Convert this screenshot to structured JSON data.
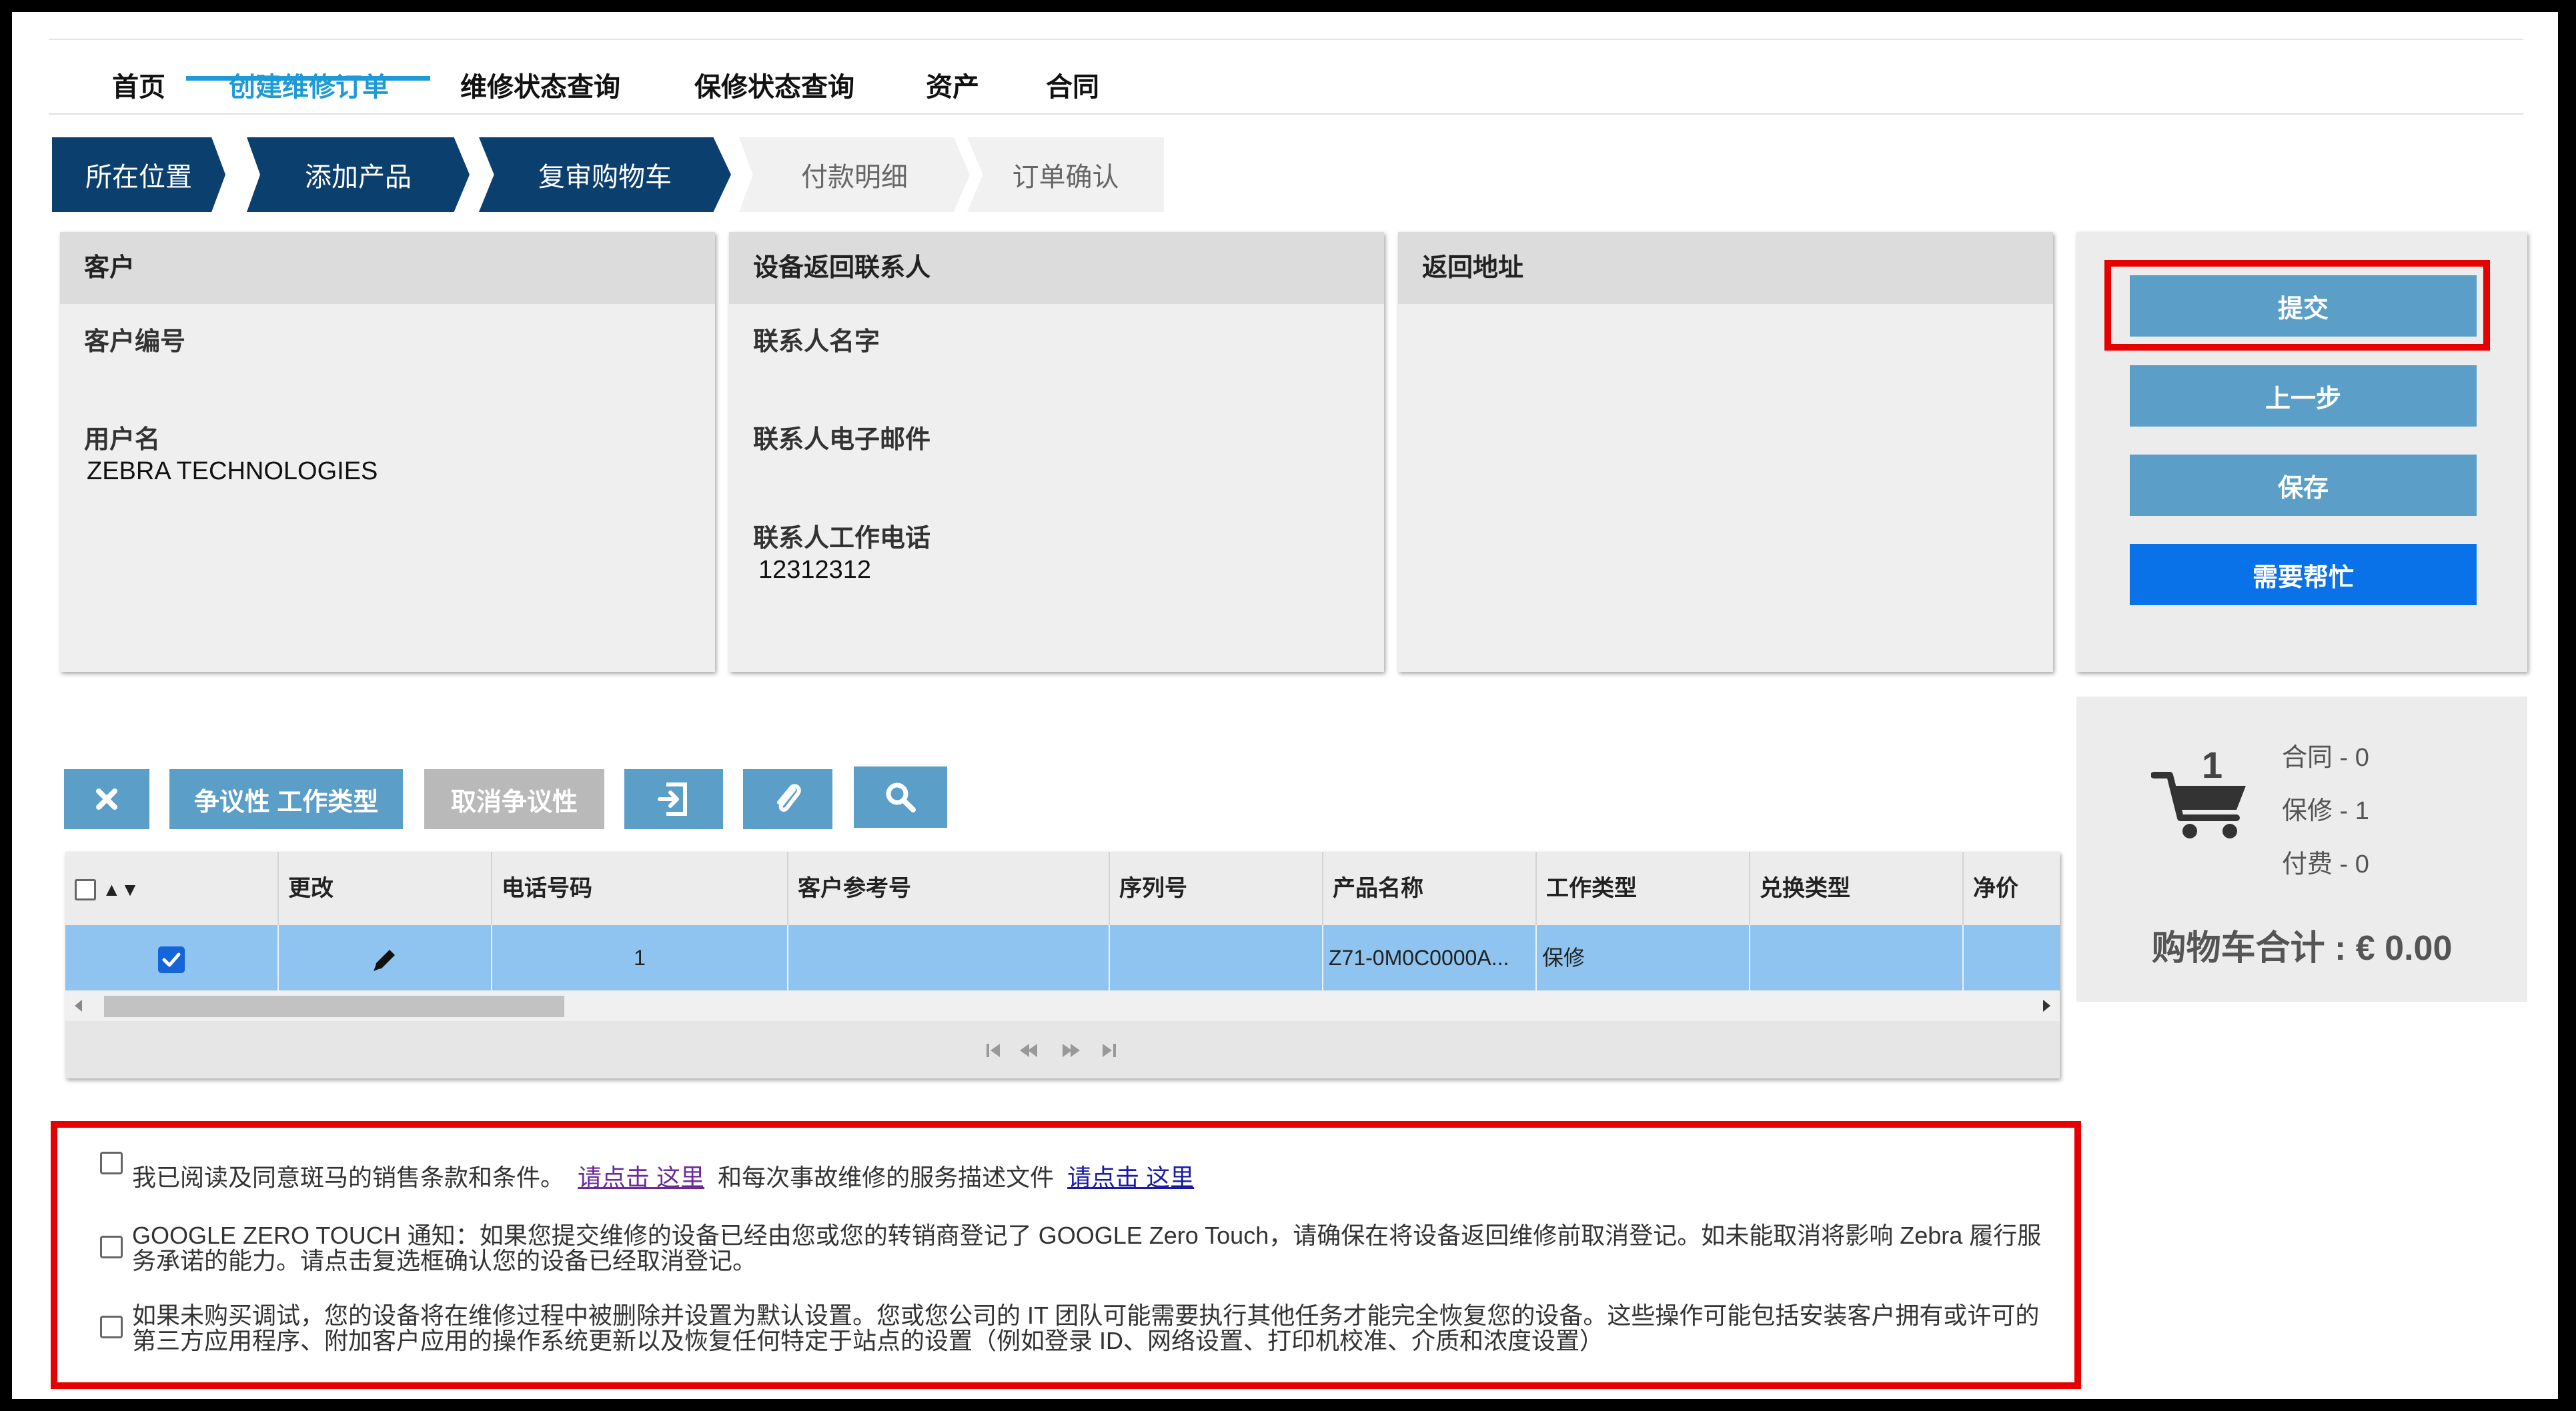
{
  "nav": {
    "items": [
      {
        "label": "首页"
      },
      {
        "label": "创建维修订单",
        "active": true
      },
      {
        "label": "维修状态查询"
      },
      {
        "label": "保修状态查询"
      },
      {
        "label": "资产"
      },
      {
        "label": "合同"
      }
    ]
  },
  "steps": [
    {
      "label": "所在位置",
      "done": true
    },
    {
      "label": "添加产品",
      "done": true
    },
    {
      "label": "复审购物车",
      "done": true
    },
    {
      "label": "付款明细",
      "done": false
    },
    {
      "label": "订单确认",
      "done": false
    }
  ],
  "customer": {
    "title": "客户",
    "number_label": "客户编号",
    "username_label": "用户名",
    "username_value": "ZEBRA TECHNOLOGIES"
  },
  "contact": {
    "title": "设备返回联系人",
    "name_label": "联系人名字",
    "email_label": "联系人电子邮件",
    "phone_label": "联系人工作电话",
    "phone_value": "12312312"
  },
  "return_address": {
    "title": "返回地址"
  },
  "actions": {
    "submit": "提交",
    "previous": "上一步",
    "save": "保存",
    "help": "需要帮忙",
    "help_color": "#0a72e8"
  },
  "cart": {
    "count": "1",
    "contract": "合同 - 0",
    "warranty": "保修 - 1",
    "paid": "付费 - 0",
    "total": "购物车合计 : € 0.00"
  },
  "toolbar": {
    "dispute": "争议性 工作类型",
    "cancel_dispute": "取消争议性"
  },
  "grid": {
    "columns": {
      "sort": "▲▼",
      "change": "更改",
      "phone": "电话号码",
      "customer_ref": "客户参考号",
      "serial": "序列号",
      "product": "产品名称",
      "work_type": "工作类型",
      "exchange_type": "兑换类型",
      "net_price": "净价"
    },
    "rows": [
      {
        "checked": true,
        "phone": "1",
        "customer_ref": "",
        "serial": "",
        "product": "Z71-0M0C0000A...",
        "work_type": "保修",
        "exchange_type": ""
      }
    ]
  },
  "terms": {
    "t1_text": "我已阅读及同意斑马的销售条款和条件。",
    "t1_link1": "请点击 这里",
    "t1_mid": "和每次事故维修的服务描述文件",
    "t1_link2": "请点击 这里",
    "t2_text": "GOOGLE ZERO TOUCH 通知：如果您提交维修的设备已经由您或您的转销商登记了 GOOGLE Zero Touch，请确保在将设备返回维修前取消登记。如未能取消将影响 Zebra 履行服务承诺的能力。请点击复选框确认您的设备已经取消登记。",
    "t3_text": "如果未购买调试，您的设备将在维修过程中被删除并设置为默认设置。您或您公司的 IT 团队可能需要执行其他任务才能完全恢复您的设备。这些操作可能包括安装客户拥有或许可的第三方应用程序、附加客户应用的操作系统更新以及恢复任何特定于站点的设置（例如登录 ID、网络设置、打印机校准、介质和浓度设置）"
  }
}
